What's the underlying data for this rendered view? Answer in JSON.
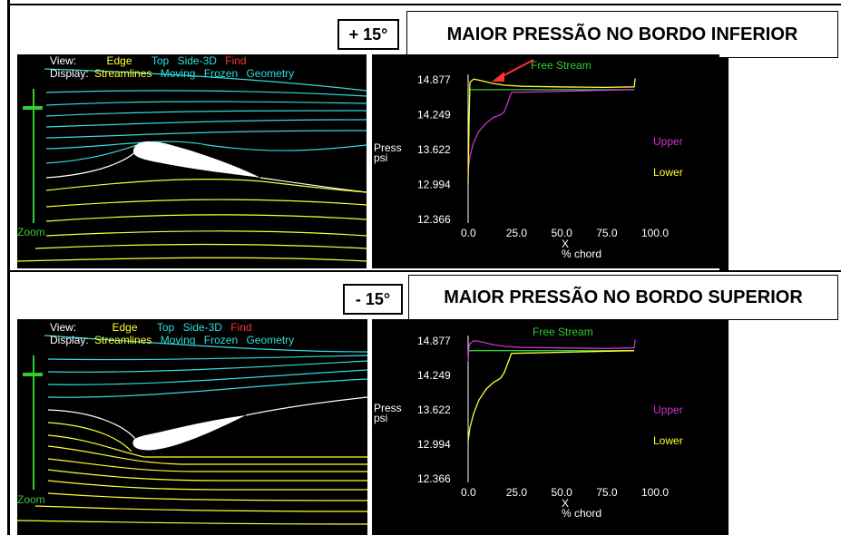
{
  "top": {
    "angle": "+ 15°",
    "title": "MAIOR PRESSÃO NO BORDO INFERIOR"
  },
  "bottom": {
    "angle": "- 15°",
    "title": "MAIOR PRESSÃO NO BORDO SUPERIOR"
  },
  "view_menu": {
    "view_label": "View:",
    "edge": "Edge",
    "top": "Top",
    "side3d": "Side-3D",
    "find": "Find",
    "display_label": "Display:",
    "streamlines": "Streamlines",
    "moving": "Moving",
    "frozen": "Frozen",
    "geometry": "Geometry",
    "zoom": "Zoom"
  },
  "plot_labels": {
    "free_stream": "Free Stream",
    "upper": "Upper",
    "lower": "Lower",
    "ylabel_1": "Press",
    "ylabel_2": "psi",
    "xlabel_1": "X",
    "xlabel_2": "% chord"
  },
  "colors": {
    "yellow": "#ffff33",
    "cyan": "#33dddd",
    "red": "#ff3333",
    "green": "#33cc33",
    "magenta": "#cc33cc",
    "white": "#ffffff"
  },
  "chart_data": [
    {
      "type": "line",
      "panel": "top",
      "xlim": [
        0,
        100
      ],
      "ylim": [
        12.366,
        14.877
      ],
      "xticks": [
        "0.0",
        "25.0",
        "50.0",
        "75.0",
        "100.0"
      ],
      "yticks": [
        "12.366",
        "12.994",
        "13.622",
        "14.249",
        "14.877"
      ],
      "series": [
        {
          "name": "Free Stream",
          "x": [
            0,
            92
          ],
          "y": [
            14.7,
            14.7
          ]
        },
        {
          "name": "Upper",
          "x": [
            0,
            1,
            3,
            6,
            10,
            14,
            18,
            20,
            24,
            92
          ],
          "y": [
            13.25,
            13.5,
            13.75,
            13.95,
            14.1,
            14.2,
            14.25,
            14.3,
            14.65,
            14.7
          ]
        },
        {
          "name": "Lower",
          "x": [
            0,
            0.5,
            1,
            3,
            6,
            10,
            14,
            20,
            30,
            50,
            75,
            92,
            92.5
          ],
          "y": [
            13.0,
            14.1,
            14.83,
            14.89,
            14.87,
            14.84,
            14.81,
            14.78,
            14.76,
            14.75,
            14.74,
            14.75,
            14.9
          ]
        }
      ]
    },
    {
      "type": "line",
      "panel": "bottom",
      "xlim": [
        0,
        100
      ],
      "ylim": [
        12.366,
        14.877
      ],
      "xticks": [
        "0.0",
        "25.0",
        "50.0",
        "75.0",
        "100.0"
      ],
      "yticks": [
        "12.366",
        "12.994",
        "13.622",
        "14.249",
        "14.877"
      ],
      "series": [
        {
          "name": "Free Stream",
          "x": [
            0,
            92
          ],
          "y": [
            14.7,
            14.7
          ]
        },
        {
          "name": "Upper",
          "x": [
            0,
            0.5,
            1,
            3,
            6,
            10,
            14,
            20,
            30,
            50,
            75,
            92,
            92.5
          ],
          "y": [
            14.5,
            14.78,
            14.83,
            14.88,
            14.87,
            14.84,
            14.81,
            14.78,
            14.76,
            14.75,
            14.74,
            14.75,
            14.9
          ]
        },
        {
          "name": "Lower",
          "x": [
            0,
            1,
            3,
            6,
            10,
            14,
            18,
            20,
            24,
            92
          ],
          "y": [
            13.05,
            13.3,
            13.55,
            13.8,
            14.0,
            14.12,
            14.2,
            14.3,
            14.65,
            14.7
          ]
        }
      ]
    }
  ]
}
